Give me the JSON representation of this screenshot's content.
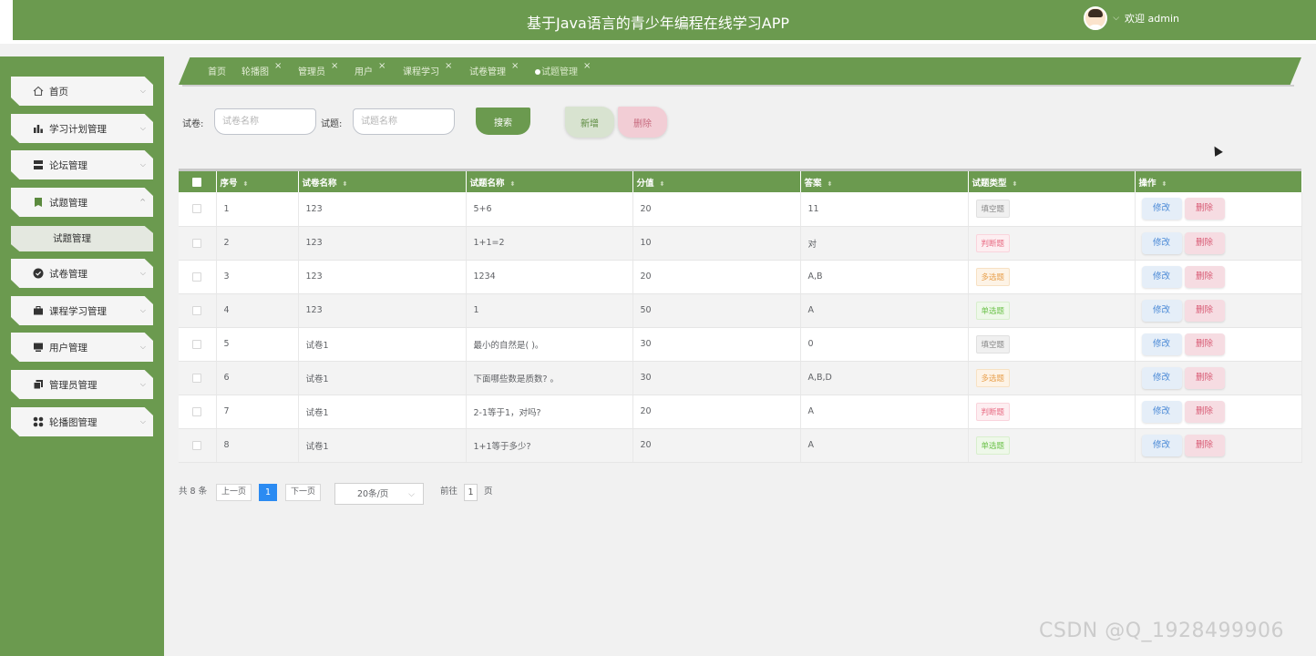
{
  "header": {
    "title": "基于Java语言的青少年编程在线学习APP",
    "welcome": "欢迎 admin",
    "caret": "⌵"
  },
  "sidebar": {
    "items": [
      {
        "label": "首页",
        "icon": "home-icon"
      },
      {
        "label": "学习计划管理",
        "icon": "chart-icon"
      },
      {
        "label": "论坛管理",
        "icon": "server-icon"
      },
      {
        "label": "试题管理",
        "icon": "book-icon"
      },
      {
        "label": "试卷管理",
        "icon": "check-circle-icon"
      },
      {
        "label": "课程学习管理",
        "icon": "briefcase-icon"
      },
      {
        "label": "用户管理",
        "icon": "monitor-icon"
      },
      {
        "label": "管理员管理",
        "icon": "copy-icon"
      },
      {
        "label": "轮播图管理",
        "icon": "grid-icon"
      }
    ],
    "sub_item": "试题管理",
    "chevron_down": "⌵",
    "chevron_up": "^"
  },
  "tabs": [
    {
      "label": "首页",
      "closable": false
    },
    {
      "label": "轮播图",
      "closable": true
    },
    {
      "label": "管理员",
      "closable": true
    },
    {
      "label": "用户",
      "closable": true
    },
    {
      "label": "课程学习",
      "closable": true
    },
    {
      "label": "试卷管理",
      "closable": true
    },
    {
      "label": "试题管理",
      "closable": true,
      "active": true
    }
  ],
  "tab_close": "×",
  "search": {
    "paper_label": "试卷:",
    "paper_placeholder": "试卷名称",
    "question_label": "试题:",
    "question_placeholder": "试题名称",
    "search_button": "搜索",
    "add_button": "新增",
    "delete_button": "删除"
  },
  "table": {
    "sort_glyph": "⬍",
    "columns": [
      "序号",
      "试卷名称",
      "试题名称",
      "分值",
      "答案",
      "试题类型",
      "操作"
    ],
    "rows": [
      {
        "no": "1",
        "paper": "123",
        "question": "5+6",
        "score": "20",
        "answer": "11",
        "type": "填空题",
        "type_kind": "fill"
      },
      {
        "no": "2",
        "paper": "123",
        "question": "1+1=2",
        "score": "10",
        "answer": "对",
        "type": "判断题",
        "type_kind": "judge"
      },
      {
        "no": "3",
        "paper": "123",
        "question": "1234",
        "score": "20",
        "answer": "A,B",
        "type": "多选题",
        "type_kind": "multi"
      },
      {
        "no": "4",
        "paper": "123",
        "question": "1",
        "score": "50",
        "answer": "A",
        "type": "单选题",
        "type_kind": "single"
      },
      {
        "no": "5",
        "paper": "试卷1",
        "question": "最小的自然是( )。",
        "score": "30",
        "answer": "0",
        "type": "填空题",
        "type_kind": "fill"
      },
      {
        "no": "6",
        "paper": "试卷1",
        "question": "下面哪些数是质数? 。",
        "score": "30",
        "answer": "A,B,D",
        "type": "多选题",
        "type_kind": "multi"
      },
      {
        "no": "7",
        "paper": "试卷1",
        "question": "2-1等于1，对吗?",
        "score": "20",
        "answer": "A",
        "type": "判断题",
        "type_kind": "judge"
      },
      {
        "no": "8",
        "paper": "试卷1",
        "question": "1+1等于多少?",
        "score": "20",
        "answer": "A",
        "type": "单选题",
        "type_kind": "single"
      }
    ],
    "edit_label": "修改",
    "delete_label": "删除"
  },
  "pagination": {
    "total_text": "共 8 条",
    "prev": "上一页",
    "current": "1",
    "next": "下一页",
    "page_size": "20条/页",
    "size_caret": "⌵",
    "goto_prefix": "前往",
    "goto_value": "1",
    "goto_suffix": "页"
  },
  "watermark": "CSDN @Q_1928499906",
  "colors": {
    "primary": "#6b9a4f",
    "current_page": "#2b8bf2"
  }
}
